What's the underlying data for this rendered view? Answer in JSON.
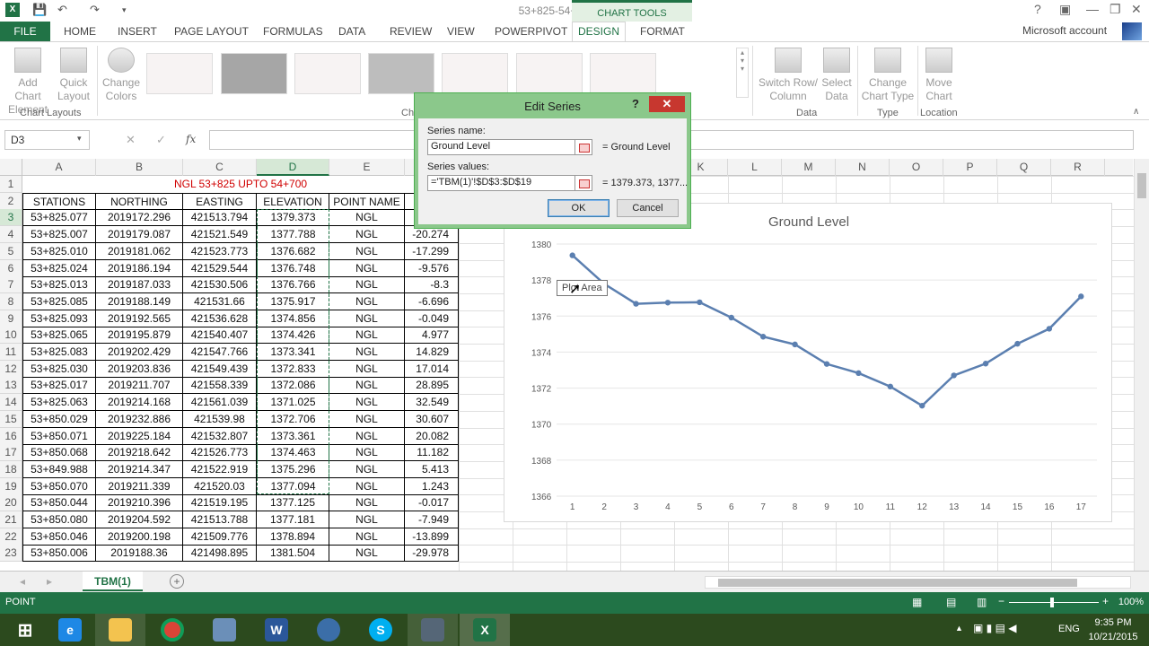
{
  "window": {
    "title": "53+825-54+700 - Excel",
    "chart_tools": "CHART TOOLS",
    "account": "Microsoft account"
  },
  "ribbon_tabs": [
    "FILE",
    "HOME",
    "INSERT",
    "PAGE LAYOUT",
    "FORMULAS",
    "DATA",
    "REVIEW",
    "VIEW",
    "POWERPIVOT",
    "DESIGN",
    "FORMAT"
  ],
  "ribbon": {
    "add_chart_element": [
      "Add Chart",
      "Element"
    ],
    "quick_layout": [
      "Quick",
      "Layout"
    ],
    "change_colors": [
      "Change",
      "Colors"
    ],
    "switch_row_column": [
      "Switch Row/",
      "Column"
    ],
    "select_data": [
      "Select",
      "Data"
    ],
    "change_chart_type": [
      "Change",
      "Chart Type"
    ],
    "move_chart": [
      "Move",
      "Chart"
    ],
    "group_chart_layouts": "Chart Layouts",
    "group_chart_styles_partial": "Ch",
    "group_data": "Data",
    "group_type": "Type",
    "group_location": "Location"
  },
  "formula_bar": {
    "name_box": "D3",
    "fx": "fx",
    "cancel": "✕",
    "enter": "✓"
  },
  "columns": [
    "A",
    "B",
    "C",
    "D",
    "E",
    "F",
    "G",
    "H",
    "I",
    "J",
    "K",
    "L",
    "M",
    "N",
    "O",
    "P",
    "Q",
    "R"
  ],
  "sheet": {
    "title": "NGL 53+825 UPTO 54+700",
    "headers": [
      "STATIONS",
      "NORTHING",
      "EASTING",
      "ELEVATION",
      "POINT NAME",
      ""
    ],
    "rows": [
      [
        "53+825.077",
        "2019172.296",
        "421513.794",
        "1379.373",
        "NGL",
        ""
      ],
      [
        "53+825.007",
        "2019179.087",
        "421521.549",
        "1377.788",
        "NGL",
        "-20.274"
      ],
      [
        "53+825.010",
        "2019181.062",
        "421523.773",
        "1376.682",
        "NGL",
        "-17.299"
      ],
      [
        "53+825.024",
        "2019186.194",
        "421529.544",
        "1376.748",
        "NGL",
        "-9.576"
      ],
      [
        "53+825.013",
        "2019187.033",
        "421530.506",
        "1376.766",
        "NGL",
        "-8.3"
      ],
      [
        "53+825.085",
        "2019188.149",
        "421531.66",
        "1375.917",
        "NGL",
        "-6.696"
      ],
      [
        "53+825.093",
        "2019192.565",
        "421536.628",
        "1374.856",
        "NGL",
        "-0.049"
      ],
      [
        "53+825.065",
        "2019195.879",
        "421540.407",
        "1374.426",
        "NGL",
        "4.977"
      ],
      [
        "53+825.083",
        "2019202.429",
        "421547.766",
        "1373.341",
        "NGL",
        "14.829"
      ],
      [
        "53+825.030",
        "2019203.836",
        "421549.439",
        "1372.833",
        "NGL",
        "17.014"
      ],
      [
        "53+825.017",
        "2019211.707",
        "421558.339",
        "1372.086",
        "NGL",
        "28.895"
      ],
      [
        "53+825.063",
        "2019214.168",
        "421561.039",
        "1371.025",
        "NGL",
        "32.549"
      ],
      [
        "53+850.029",
        "2019232.886",
        "421539.98",
        "1372.706",
        "NGL",
        "30.607"
      ],
      [
        "53+850.071",
        "2019225.184",
        "421532.807",
        "1373.361",
        "NGL",
        "20.082"
      ],
      [
        "53+850.068",
        "2019218.642",
        "421526.773",
        "1374.463",
        "NGL",
        "11.182"
      ],
      [
        "53+849.988",
        "2019214.347",
        "421522.919",
        "1375.296",
        "NGL",
        "5.413"
      ],
      [
        "53+850.070",
        "2019211.339",
        "421520.03",
        "1377.094",
        "NGL",
        "1.243"
      ],
      [
        "53+850.044",
        "2019210.396",
        "421519.195",
        "1377.125",
        "NGL",
        "-0.017"
      ],
      [
        "53+850.080",
        "2019204.592",
        "421513.788",
        "1377.181",
        "NGL",
        "-7.949"
      ],
      [
        "53+850.046",
        "2019200.198",
        "421509.776",
        "1378.894",
        "NGL",
        "-13.899"
      ],
      [
        "53+850.006",
        "2019188.36",
        "421498.895",
        "1381.504",
        "NGL",
        "-29.978"
      ]
    ]
  },
  "dialog": {
    "title": "Edit Series",
    "help": "?",
    "close": "✕",
    "series_name_label": "Series name:",
    "series_name_value": "Ground Level",
    "series_name_preview": "= Ground Level",
    "series_values_label": "Series values:",
    "series_values_value": "='TBM(1)'!$D$3:$D$19",
    "series_values_preview": "= 1379.373, 1377...",
    "ok": "OK",
    "cancel": "Cancel"
  },
  "tooltip": "Plot Area",
  "chart_data": {
    "type": "line",
    "title": "Ground Level",
    "categories": [
      "1",
      "2",
      "3",
      "4",
      "5",
      "6",
      "7",
      "8",
      "9",
      "10",
      "11",
      "12",
      "13",
      "14",
      "15",
      "16",
      "17"
    ],
    "series": [
      {
        "values": [
          1379.373,
          1377.788,
          1376.682,
          1376.748,
          1376.766,
          1375.917,
          1374.856,
          1374.426,
          1373.341,
          1372.833,
          1372.086,
          1371.025,
          1372.706,
          1373.361,
          1374.463,
          1375.296,
          1377.094
        ],
        "color": "#5b7fb0"
      }
    ],
    "ylim": [
      1366,
      1380
    ],
    "yticks": [
      1366,
      1368,
      1370,
      1372,
      1374,
      1376,
      1378,
      1380
    ],
    "grid": true,
    "legend": "none"
  },
  "sheet_tabs": {
    "active": "TBM(1)",
    "add": "+"
  },
  "status": {
    "mode": "POINT",
    "zoom": "100%"
  },
  "taskbar": {
    "lang": "ENG",
    "time": "9:35 PM",
    "date": "10/21/2015"
  },
  "colors": {
    "excel_green": "#217346",
    "dialog_header": "#8bc88b",
    "close_red": "#c7372f"
  }
}
